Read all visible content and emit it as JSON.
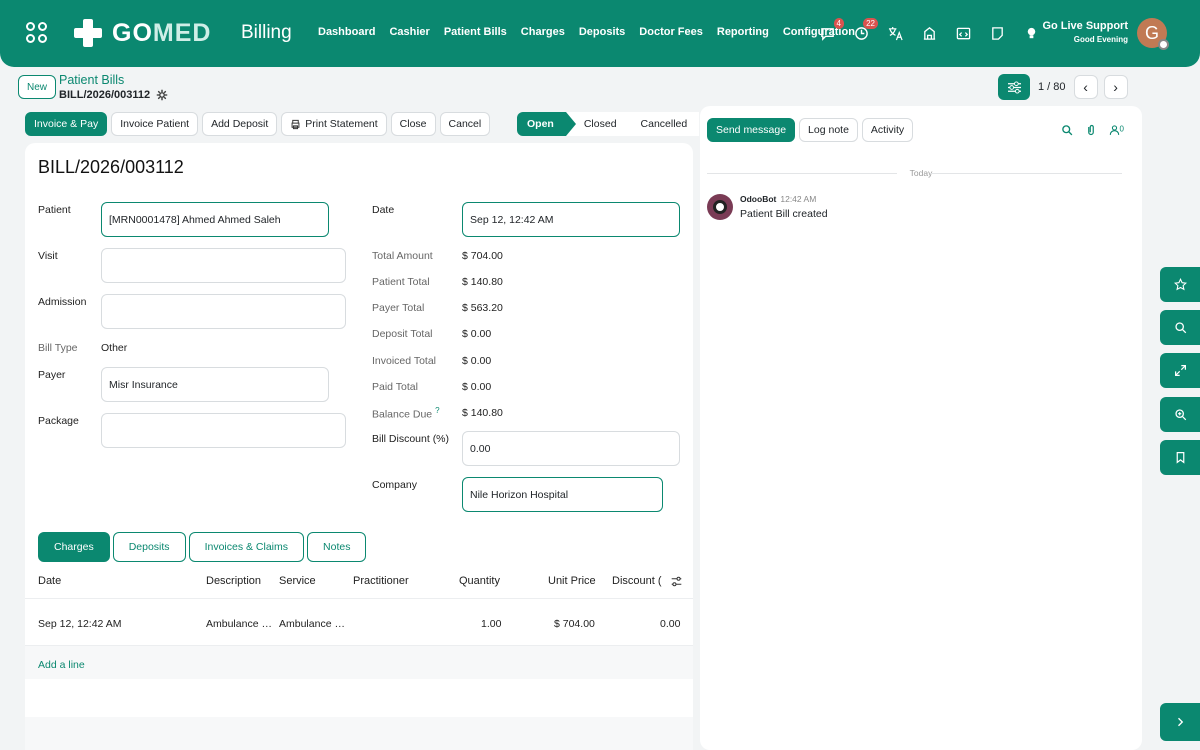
{
  "app": {
    "brand_go": "GO",
    "brand_med": "MED",
    "title": "Billing",
    "menu": [
      "Dashboard",
      "Cashier",
      "Patient Bills",
      "Charges",
      "Deposits",
      "Doctor Fees",
      "Reporting",
      "Configuration"
    ],
    "badges": {
      "chat": "4",
      "activity": "22"
    },
    "support_title": "Go Live Support",
    "support_greeting": "Good Evening",
    "avatar_letter": "G"
  },
  "control": {
    "new_label": "New",
    "breadcrumb_parent": "Patient Bills",
    "breadcrumb_current": "BILL/2026/003112",
    "pager": "1 / 80"
  },
  "actions": [
    "Invoice & Pay",
    "Invoice Patient",
    "Add Deposit",
    "Print Statement",
    "Close",
    "Cancel"
  ],
  "statusbar": {
    "open": "Open",
    "closed": "Closed",
    "cancelled": "Cancelled"
  },
  "form": {
    "title": "BILL/2026/003112",
    "labels": {
      "patient": "Patient",
      "visit": "Visit",
      "admission": "Admission",
      "bill_type": "Bill Type",
      "payer": "Payer",
      "package": "Package",
      "date": "Date",
      "total_amount": "Total Amount",
      "patient_total": "Patient Total",
      "payer_total": "Payer Total",
      "deposit_total": "Deposit Total",
      "invoiced_total": "Invoiced Total",
      "paid_total": "Paid Total",
      "balance_due": "Balance Due",
      "balance_help": "?",
      "bill_discount": "Bill Discount (%)",
      "company": "Company"
    },
    "values": {
      "patient": "[MRN0001478] Ahmed Ahmed Saleh",
      "visit": "",
      "admission": "",
      "bill_type": "Other",
      "payer": "Misr Insurance",
      "package": "",
      "date": "Sep 12, 12:42 AM",
      "total_amount": "$ 704.00",
      "patient_total": "$ 140.80",
      "payer_total": "$ 563.20",
      "deposit_total": "$ 0.00",
      "invoiced_total": "$ 0.00",
      "paid_total": "$ 0.00",
      "balance_due": "$ 140.80",
      "bill_discount": "0.00",
      "company": "Nile Horizon Hospital"
    }
  },
  "tabs": [
    "Charges",
    "Deposits",
    "Invoices & Claims",
    "Notes"
  ],
  "table": {
    "headers": [
      "Date",
      "Description",
      "Service",
      "Practitioner",
      "Quantity",
      "Unit Price",
      "Discount ("
    ],
    "rows": [
      {
        "date": "Sep 12, 12:42 AM",
        "description": "Ambulance …",
        "service": "Ambulance …",
        "practitioner": "",
        "quantity": "1.00",
        "unit_price": "$ 704.00",
        "discount": "0.00"
      }
    ],
    "add_line": "Add a line"
  },
  "chatter": {
    "send_message": "Send message",
    "log_note": "Log note",
    "activity": "Activity",
    "followers_count": "0",
    "today": "Today",
    "author": "OdooBot",
    "time": "12:42 AM",
    "message": "Patient Bill created"
  }
}
